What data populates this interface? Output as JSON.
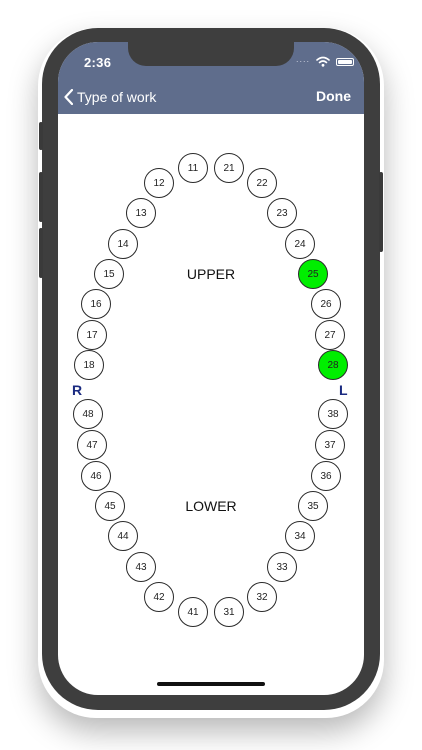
{
  "status_bar": {
    "time": "2:36",
    "dots": "....",
    "wifi_icon": "wifi-icon",
    "battery_icon": "battery-icon"
  },
  "nav": {
    "back_label": "Type of work",
    "back_icon": "chevron-left-icon",
    "done_label": "Done"
  },
  "colors": {
    "header": "#5f6d8c",
    "selected_tooth": "#00ee00",
    "side_label": "#1a2a80"
  },
  "labels": {
    "upper": "UPPER",
    "lower": "LOWER",
    "right": "R",
    "left": "L"
  },
  "teeth": [
    {
      "number": "11",
      "selected": false
    },
    {
      "number": "21",
      "selected": false
    },
    {
      "number": "12",
      "selected": false
    },
    {
      "number": "22",
      "selected": false
    },
    {
      "number": "13",
      "selected": false
    },
    {
      "number": "23",
      "selected": false
    },
    {
      "number": "14",
      "selected": false
    },
    {
      "number": "24",
      "selected": false
    },
    {
      "number": "15",
      "selected": false
    },
    {
      "number": "25",
      "selected": true
    },
    {
      "number": "16",
      "selected": false
    },
    {
      "number": "26",
      "selected": false
    },
    {
      "number": "17",
      "selected": false
    },
    {
      "number": "27",
      "selected": false
    },
    {
      "number": "18",
      "selected": false
    },
    {
      "number": "28",
      "selected": true
    },
    {
      "number": "48",
      "selected": false
    },
    {
      "number": "38",
      "selected": false
    },
    {
      "number": "47",
      "selected": false
    },
    {
      "number": "37",
      "selected": false
    },
    {
      "number": "46",
      "selected": false
    },
    {
      "number": "36",
      "selected": false
    },
    {
      "number": "45",
      "selected": false
    },
    {
      "number": "35",
      "selected": false
    },
    {
      "number": "44",
      "selected": false
    },
    {
      "number": "34",
      "selected": false
    },
    {
      "number": "43",
      "selected": false
    },
    {
      "number": "33",
      "selected": false
    },
    {
      "number": "42",
      "selected": false
    },
    {
      "number": "32",
      "selected": false
    },
    {
      "number": "41",
      "selected": false
    },
    {
      "number": "31",
      "selected": false
    }
  ]
}
